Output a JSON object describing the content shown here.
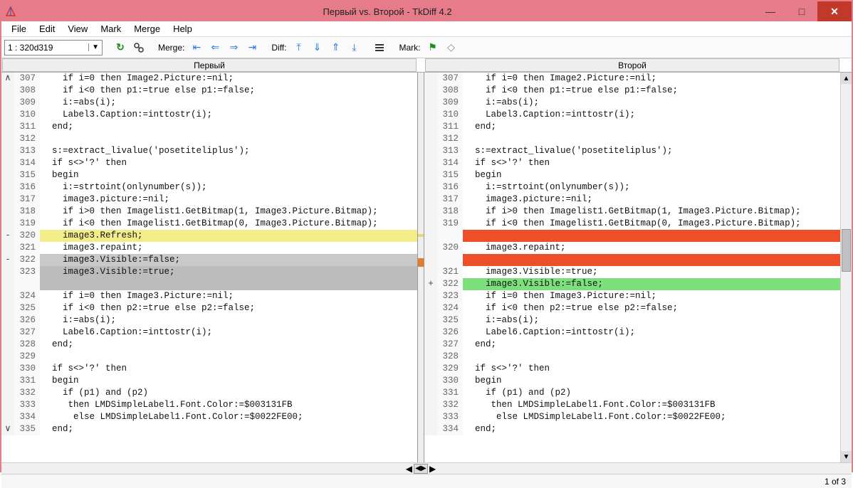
{
  "window": {
    "title": "Первый vs. Второй - TkDiff 4.2",
    "minimize": "—",
    "maximize": "□",
    "close": "✕"
  },
  "menu": [
    "File",
    "Edit",
    "View",
    "Mark",
    "Merge",
    "Help"
  ],
  "toolbar": {
    "combo_value": "1  : 320d319",
    "merge_label": "Merge:",
    "diff_label": "Diff:",
    "mark_label": "Mark:"
  },
  "headers": {
    "left": "Первый",
    "right": "Второй"
  },
  "left_lines": [
    {
      "g": "∧",
      "n": "307",
      "t": "    if i=0 then Image2.Picture:=nil;"
    },
    {
      "g": "",
      "n": "308",
      "t": "    if i<0 then p1:=true else p1:=false;"
    },
    {
      "g": "",
      "n": "309",
      "t": "    i:=abs(i);"
    },
    {
      "g": "",
      "n": "310",
      "t": "    Label3.Caption:=inttostr(i);"
    },
    {
      "g": "",
      "n": "311",
      "t": "  end;"
    },
    {
      "g": "",
      "n": "312",
      "t": ""
    },
    {
      "g": "",
      "n": "313",
      "t": "  s:=extract_livalue('posetiteliplus');"
    },
    {
      "g": "",
      "n": "314",
      "t": "  if s<>'?' then"
    },
    {
      "g": "",
      "n": "315",
      "t": "  begin"
    },
    {
      "g": "",
      "n": "316",
      "t": "    i:=strtoint(onlynumber(s));"
    },
    {
      "g": "",
      "n": "317",
      "t": "    image3.picture:=nil;"
    },
    {
      "g": "",
      "n": "318",
      "t": "    if i>0 then Imagelist1.GetBitmap(1, Image3.Picture.Bitmap);"
    },
    {
      "g": "",
      "n": "319",
      "t": "    if i<0 then Imagelist1.GetBitmap(0, Image3.Picture.Bitmap);"
    },
    {
      "g": "-",
      "n": "320",
      "t": "    image3.Refresh;",
      "cls": "hl-yellow"
    },
    {
      "g": "",
      "n": "321",
      "t": "    image3.repaint;"
    },
    {
      "g": "-",
      "n": "322",
      "t": "    image3.Visible:=false;",
      "cls": "hl-grey"
    },
    {
      "g": "",
      "n": "323",
      "t": "    image3.Visible:=true;",
      "cls": "hl-greydark"
    },
    {
      "g": "",
      "n": "",
      "t": "",
      "cls": "hl-greydark"
    },
    {
      "g": "",
      "n": "324",
      "t": "    if i=0 then Image3.Picture:=nil;"
    },
    {
      "g": "",
      "n": "325",
      "t": "    if i<0 then p2:=true else p2:=false;"
    },
    {
      "g": "",
      "n": "326",
      "t": "    i:=abs(i);"
    },
    {
      "g": "",
      "n": "327",
      "t": "    Label6.Caption:=inttostr(i);"
    },
    {
      "g": "",
      "n": "328",
      "t": "  end;"
    },
    {
      "g": "",
      "n": "329",
      "t": ""
    },
    {
      "g": "",
      "n": "330",
      "t": "  if s<>'?' then"
    },
    {
      "g": "",
      "n": "331",
      "t": "  begin"
    },
    {
      "g": "",
      "n": "332",
      "t": "    if (p1) and (p2)"
    },
    {
      "g": "",
      "n": "333",
      "t": "     then LMDSimpleLabel1.Font.Color:=$003131FB"
    },
    {
      "g": "",
      "n": "334",
      "t": "      else LMDSimpleLabel1.Font.Color:=$0022FE00;"
    },
    {
      "g": "∨",
      "n": "335",
      "t": "  end;"
    }
  ],
  "right_lines": [
    {
      "g": "",
      "n": "307",
      "t": "    if i=0 then Image2.Picture:=nil;"
    },
    {
      "g": "",
      "n": "308",
      "t": "    if i<0 then p1:=true else p1:=false;"
    },
    {
      "g": "",
      "n": "309",
      "t": "    i:=abs(i);"
    },
    {
      "g": "",
      "n": "310",
      "t": "    Label3.Caption:=inttostr(i);"
    },
    {
      "g": "",
      "n": "311",
      "t": "  end;"
    },
    {
      "g": "",
      "n": "312",
      "t": ""
    },
    {
      "g": "",
      "n": "313",
      "t": "  s:=extract_livalue('posetiteliplus');"
    },
    {
      "g": "",
      "n": "314",
      "t": "  if s<>'?' then"
    },
    {
      "g": "",
      "n": "315",
      "t": "  begin"
    },
    {
      "g": "",
      "n": "316",
      "t": "    i:=strtoint(onlynumber(s));"
    },
    {
      "g": "",
      "n": "317",
      "t": "    image3.picture:=nil;"
    },
    {
      "g": "",
      "n": "318",
      "t": "    if i>0 then Imagelist1.GetBitmap(1, Image3.Picture.Bitmap);"
    },
    {
      "g": "",
      "n": "319",
      "t": "    if i<0 then Imagelist1.GetBitmap(0, Image3.Picture.Bitmap);"
    },
    {
      "g": "",
      "n": "",
      "t": "",
      "cls": "hl-red"
    },
    {
      "g": "",
      "n": "320",
      "t": "    image3.repaint;"
    },
    {
      "g": "",
      "n": "",
      "t": "",
      "cls": "hl-red"
    },
    {
      "g": "",
      "n": "321",
      "t": "    image3.Visible:=true;"
    },
    {
      "g": "+",
      "n": "322",
      "t": "    image3.Visible:=false;",
      "cls": "hl-green"
    },
    {
      "g": "",
      "n": "323",
      "t": "    if i=0 then Image3.Picture:=nil;"
    },
    {
      "g": "",
      "n": "324",
      "t": "    if i<0 then p2:=true else p2:=false;"
    },
    {
      "g": "",
      "n": "325",
      "t": "    i:=abs(i);"
    },
    {
      "g": "",
      "n": "326",
      "t": "    Label6.Caption:=inttostr(i);"
    },
    {
      "g": "",
      "n": "327",
      "t": "  end;"
    },
    {
      "g": "",
      "n": "328",
      "t": ""
    },
    {
      "g": "",
      "n": "329",
      "t": "  if s<>'?' then"
    },
    {
      "g": "",
      "n": "330",
      "t": "  begin"
    },
    {
      "g": "",
      "n": "331",
      "t": "    if (p1) and (p2)"
    },
    {
      "g": "",
      "n": "332",
      "t": "     then LMDSimpleLabel1.Font.Color:=$003131FB"
    },
    {
      "g": "",
      "n": "333",
      "t": "      else LMDSimpleLabel1.Font.Color:=$0022FE00;"
    },
    {
      "g": "",
      "n": "334",
      "t": "  end;"
    }
  ],
  "status": {
    "position": "1 of 3"
  }
}
